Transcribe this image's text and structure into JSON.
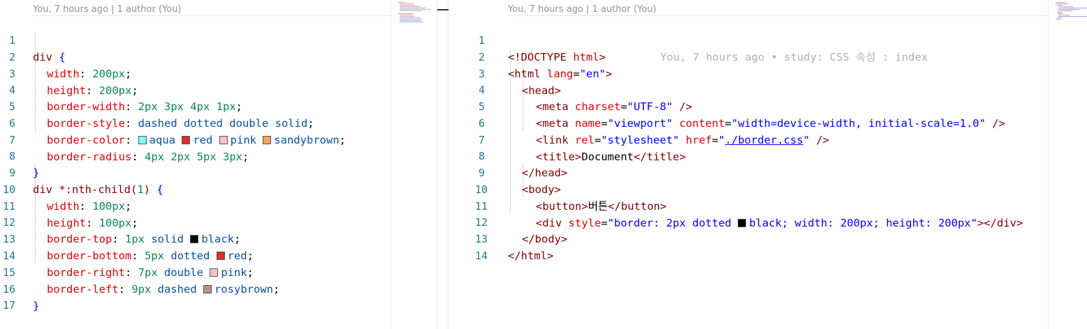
{
  "left_editor": {
    "codelens": "You, 7 hours ago | 1 author (You)",
    "line_numbers": [
      "1",
      "2",
      "3",
      "4",
      "5",
      "6",
      "7",
      "8",
      "9",
      "10",
      "11",
      "12",
      "13",
      "14",
      "15",
      "16",
      "17"
    ],
    "tokens": {
      "l1": [
        "div",
        "{"
      ],
      "l2": [
        "width",
        ": ",
        "200px",
        ";"
      ],
      "l3": [
        "height",
        ": ",
        "200px",
        ";"
      ],
      "l4": [
        "border-width",
        ": ",
        "2px 3px 4px 1px",
        ";"
      ],
      "l5": [
        "border-style",
        ": ",
        "dashed dotted double solid",
        ";"
      ],
      "l6": [
        "border-color",
        ": ",
        "aqua",
        "red",
        "pink",
        "sandybrown",
        ";"
      ],
      "l7": [
        "border-radius",
        ": ",
        "4px 2px 5px 3px",
        ";"
      ],
      "l8": [
        "}"
      ],
      "l9": [
        "div *:nth-child(",
        "1",
        ")",
        "{"
      ],
      "l10": [
        "width",
        ": ",
        "100px",
        ";"
      ],
      "l11": [
        "height",
        ": ",
        "100px",
        ";"
      ],
      "l12": [
        "border-top",
        ": ",
        "1px",
        "solid",
        "black",
        ";"
      ],
      "l13": [
        "border-bottom",
        ": ",
        "5px",
        "dotted",
        "red",
        ";"
      ],
      "l14": [
        "border-right",
        ": ",
        "7px",
        "double",
        "pink",
        ";"
      ],
      "l15": [
        "border-left",
        ": ",
        "9px",
        "dashed",
        "rosybrown",
        ";"
      ],
      "l16": [
        "}"
      ]
    }
  },
  "right_editor": {
    "codelens": "You, 7 hours ago | 1 author (You)",
    "blame": "You, 7 hours ago • study: CSS 속성 : index",
    "line_numbers": [
      "1",
      "2",
      "3",
      "4",
      "5",
      "6",
      "7",
      "8",
      "9",
      "10",
      "11",
      "12",
      "13",
      "14"
    ],
    "tokens": {
      "l1": [
        "<!DOCTYPE ",
        "html",
        ">"
      ],
      "l2": [
        "<",
        "html",
        " lang",
        "=",
        "\"en\"",
        ">"
      ],
      "l3": [
        "<",
        "head",
        ">"
      ],
      "l4": [
        "<",
        "meta",
        " charset",
        "=",
        "\"UTF-8\"",
        " />"
      ],
      "l5": [
        "<",
        "meta",
        " name",
        "=",
        "\"viewport\"",
        " content",
        "=",
        "\"width=device-width, initial-scale=1.0\"",
        " />"
      ],
      "l6": [
        "<",
        "link",
        " rel",
        "=",
        "\"stylesheet\"",
        " href",
        "=",
        "\"",
        "./border.css",
        "\"",
        " />"
      ],
      "l7": [
        "<",
        "title",
        ">",
        "Document",
        "</",
        "title",
        ">"
      ],
      "l8": [
        "</",
        "head",
        ">"
      ],
      "l9": [
        "<",
        "body",
        ">"
      ],
      "l10": [
        "<",
        "button",
        ">",
        "버튼",
        "</",
        "button",
        ">"
      ],
      "l11": [
        "<",
        "div",
        " style",
        "=",
        "\"border: 2px dotted ",
        "black; width: 200px; height: 200px\"",
        "></",
        "div",
        ">"
      ],
      "l12": [
        "</",
        "body",
        ">"
      ],
      "l13": [
        "</",
        "html",
        ">"
      ]
    }
  },
  "colors": {
    "aqua": "#7fffff",
    "red": "#e02b2b",
    "pink": "#ffc0cb",
    "sandybrown": "#f4a460",
    "black": "#000000",
    "rosybrown": "#bc8f8f"
  }
}
